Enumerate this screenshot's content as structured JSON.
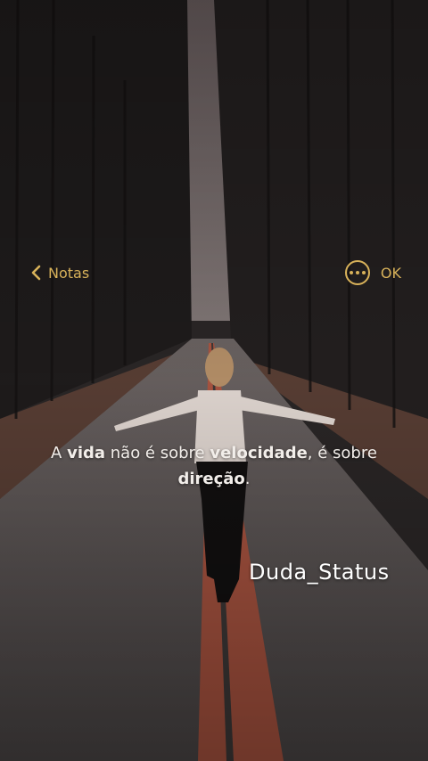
{
  "nav": {
    "back_label": "Notas",
    "done_label": "OK"
  },
  "quote": {
    "p1": "A ",
    "b1": "vida",
    "p2": " não é sobre ",
    "b2": "velocidade",
    "p3": ", é sobre ",
    "b3": "direção",
    "p4": "."
  },
  "watermark": "Duda_Status",
  "colors": {
    "accent": "#d8b25a",
    "text": "#f2eeea"
  },
  "icons": [
    "chevron-left-icon",
    "more-icon"
  ]
}
